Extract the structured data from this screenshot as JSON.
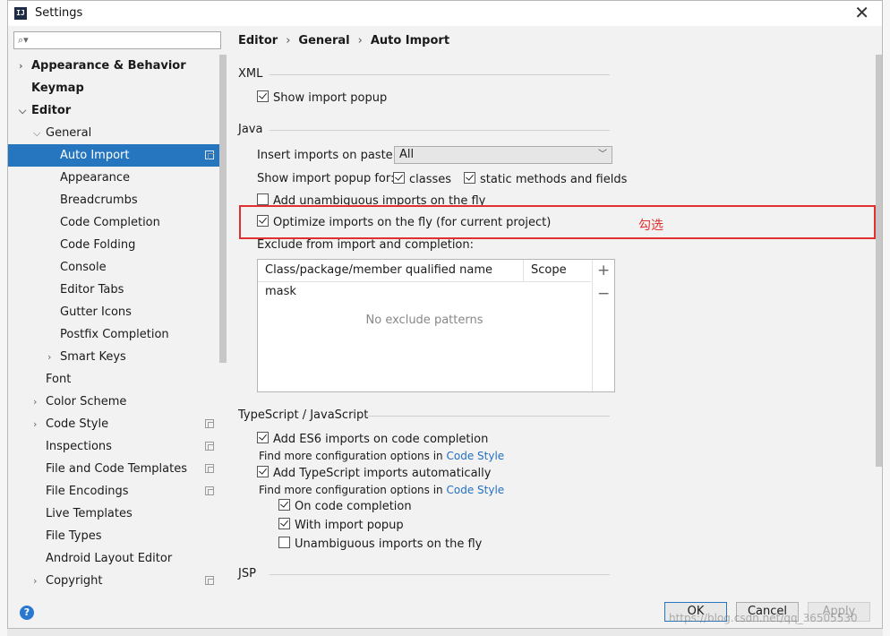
{
  "window": {
    "title": "Settings",
    "app_icon": "IJ"
  },
  "search": {
    "placeholder": ""
  },
  "sidebar": {
    "items": [
      {
        "label": "Appearance & Behavior",
        "level": 0,
        "arrow": "right",
        "bold": true
      },
      {
        "label": "Keymap",
        "level": 0,
        "bold": true
      },
      {
        "label": "Editor",
        "level": 0,
        "arrow": "down",
        "bold": true
      },
      {
        "label": "General",
        "level": 1,
        "arrow": "down"
      },
      {
        "label": "Auto Import",
        "level": 2,
        "selected": true,
        "copy": true
      },
      {
        "label": "Appearance",
        "level": 2
      },
      {
        "label": "Breadcrumbs",
        "level": 2
      },
      {
        "label": "Code Completion",
        "level": 2
      },
      {
        "label": "Code Folding",
        "level": 2
      },
      {
        "label": "Console",
        "level": 2
      },
      {
        "label": "Editor Tabs",
        "level": 2
      },
      {
        "label": "Gutter Icons",
        "level": 2
      },
      {
        "label": "Postfix Completion",
        "level": 2
      },
      {
        "label": "Smart Keys",
        "level": 2,
        "arrow": "right"
      },
      {
        "label": "Font",
        "level": 1
      },
      {
        "label": "Color Scheme",
        "level": 1,
        "arrow": "right"
      },
      {
        "label": "Code Style",
        "level": 1,
        "arrow": "right",
        "copy": true
      },
      {
        "label": "Inspections",
        "level": 1,
        "copy": true
      },
      {
        "label": "File and Code Templates",
        "level": 1,
        "copy": true
      },
      {
        "label": "File Encodings",
        "level": 1,
        "copy": true
      },
      {
        "label": "Live Templates",
        "level": 1
      },
      {
        "label": "File Types",
        "level": 1
      },
      {
        "label": "Android Layout Editor",
        "level": 1
      },
      {
        "label": "Copyright",
        "level": 1,
        "arrow": "right",
        "copy": true
      }
    ]
  },
  "breadcrumb": {
    "parts": [
      "Editor",
      "General",
      "Auto Import"
    ]
  },
  "xml": {
    "heading": "XML",
    "show_import_popup": {
      "label": "Show import popup",
      "checked": true
    }
  },
  "java": {
    "heading": "Java",
    "insert_imports_label": "Insert imports on paste:",
    "insert_imports_value": "All",
    "show_popup_for_label": "Show import popup for:",
    "classes": {
      "label": "classes",
      "checked": true
    },
    "static_methods": {
      "label": "static methods and fields",
      "checked": true
    },
    "add_unambiguous": {
      "label": "Add unambiguous imports on the fly",
      "checked": false
    },
    "optimize": {
      "label": "Optimize imports on the fly (for current project)",
      "checked": true
    },
    "annotation": "勾选",
    "exclude_label": "Exclude from import and completion:",
    "table": {
      "columns": [
        "Class/package/member qualified name mask",
        "Scope"
      ],
      "empty_text": "No exclude patterns",
      "add": "+",
      "remove": "−"
    }
  },
  "typescript": {
    "heading": "TypeScript / JavaScript",
    "add_es6": {
      "label": "Add ES6 imports on code completion",
      "checked": true
    },
    "find_more_1": "Find more configuration options in ",
    "code_style_link_1": "Code Style",
    "add_ts": {
      "label": "Add TypeScript imports automatically",
      "checked": true
    },
    "find_more_2": "Find more configuration options in ",
    "code_style_link_2": "Code Style",
    "on_completion": {
      "label": "On code completion",
      "checked": true
    },
    "with_popup": {
      "label": "With import popup",
      "checked": true
    },
    "unambiguous_fly": {
      "label": "Unambiguous imports on the fly",
      "checked": false
    }
  },
  "jsp": {
    "heading": "JSP"
  },
  "buttons": {
    "help": "?",
    "ok": "OK",
    "cancel": "Cancel",
    "apply": "Apply"
  },
  "watermark": "https://blog.csdn.net/qq_36505530",
  "colors": {
    "accent": "#2675bf",
    "annotation": "#e03030",
    "link": "#2470c2"
  }
}
